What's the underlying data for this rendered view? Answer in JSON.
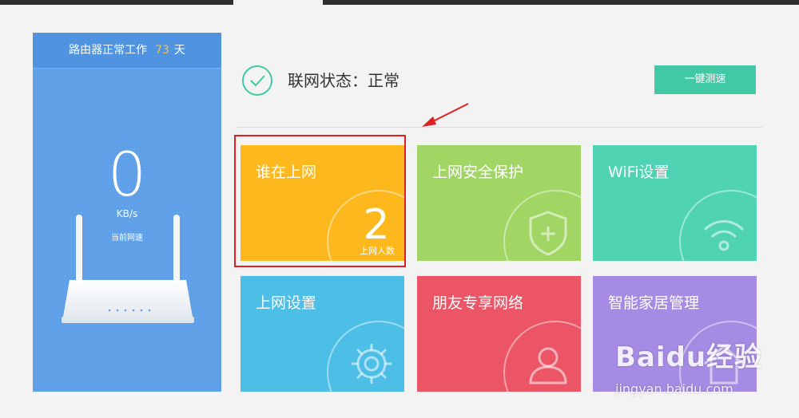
{
  "uptime": {
    "prefix": "路由器正常工作",
    "days": "73",
    "suffix": "天"
  },
  "speed": {
    "value": "0",
    "unit": "KB/s",
    "label": "当前网速"
  },
  "status": {
    "text": "联网状态：正常"
  },
  "speedtest_button": {
    "label": "一键测速"
  },
  "tiles": [
    {
      "title": "谁在上网",
      "count": "2",
      "count_label": "上网人数",
      "color": "#fcb81c"
    },
    {
      "title": "上网安全保护",
      "icon": "shield-plus-icon",
      "color": "#a1d665"
    },
    {
      "title": "WiFi设置",
      "icon": "wifi-icon",
      "color": "#4fd3b3"
    },
    {
      "title": "上网设置",
      "icon": "gear-icon",
      "color": "#4dbfe7"
    },
    {
      "title": "朋友专享网络",
      "icon": "user-icon",
      "color": "#ec5566"
    },
    {
      "title": "智能家居管理",
      "icon": "home-icon",
      "color": "#a58be3"
    }
  ],
  "watermark": {
    "brand": "Baidu经验",
    "url": "jingyan.baidu.com"
  }
}
